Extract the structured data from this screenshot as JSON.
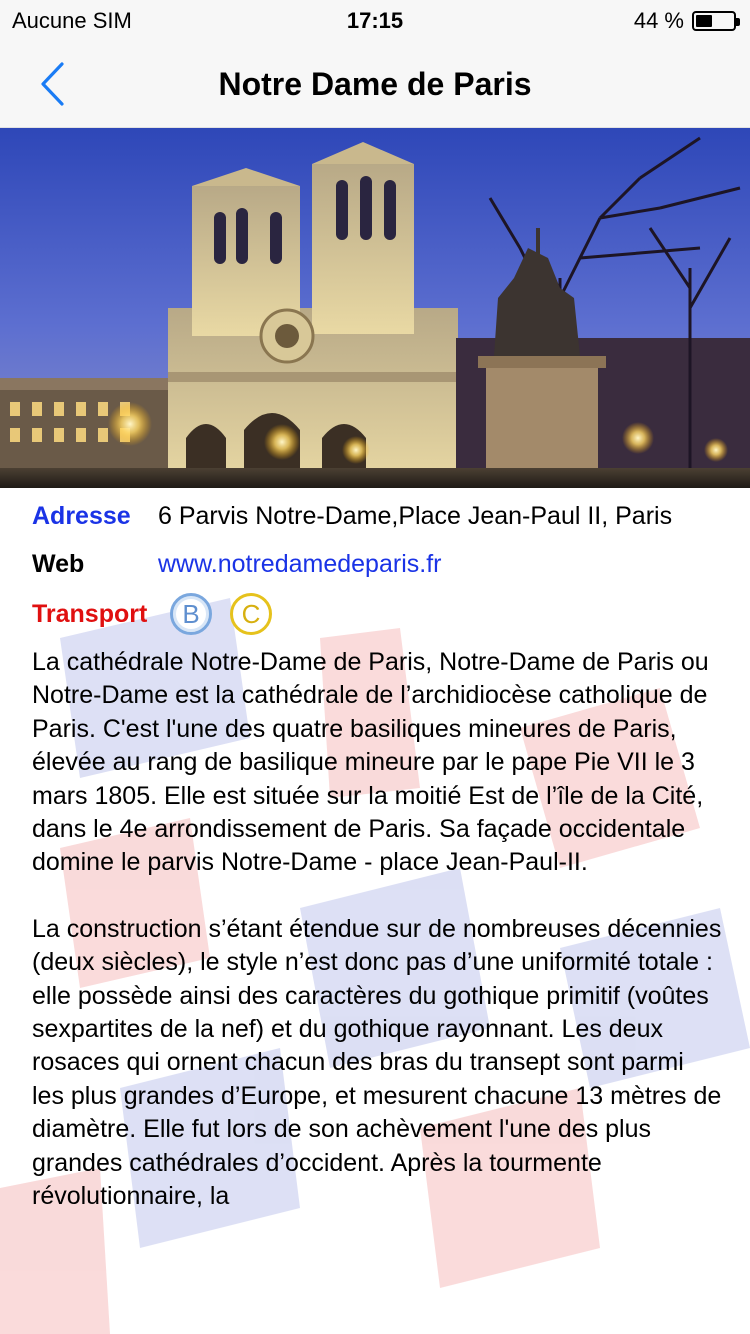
{
  "status_bar": {
    "carrier": "Aucune SIM",
    "time": "17:15",
    "battery_text": "44 %",
    "battery_level": 0.44
  },
  "nav": {
    "title": "Notre Dame de Paris",
    "back_icon": "chevron-left-icon",
    "accent_color": "#1a7cf5"
  },
  "info": {
    "address_label": "Adresse",
    "address_value": "6 Parvis Notre-Dame,Place Jean-Paul II, Paris",
    "web_label": "Web",
    "web_value": "www.notredamedeparis.fr",
    "transport_label": "Transport",
    "transport_lines": [
      "B",
      "C"
    ]
  },
  "description": [
    "La cathédrale Notre-Dame de Paris, Notre-Dame de Paris ou Notre-Dame est la cathédrale de l’archidiocèse catholique de Paris. C'est l'une des quatre basiliques mineures de Paris, élevée au rang de basilique mineure par le pape Pie VII le 3 mars 1805. Elle est située sur la moitié Est de l’île de la Cité, dans le 4e arrondissement de Paris. Sa façade occidentale domine le parvis Notre-Dame - place Jean-Paul-II.",
    "La construction s’étant étendue sur de nombreuses décennies (deux siècles), le style n’est donc pas d’une uniformité totale : elle possède ainsi des caractères du gothique primitif (voûtes sexpartites de la nef) et du gothique rayonnant. Les deux rosaces qui ornent chacun des bras du transept sont parmi les plus grandes d’Europe, et mesurent chacune 13 mètres de diamètre. Elle fut lors de son achèvement l'une des plus grandes cathédrales d’occident. Après la tourmente révolutionnaire, la"
  ],
  "colors": {
    "label_blue": "#1a33e6",
    "label_red": "#e01010",
    "badge_b": "#7aa7de",
    "badge_c": "#e6c21c"
  }
}
